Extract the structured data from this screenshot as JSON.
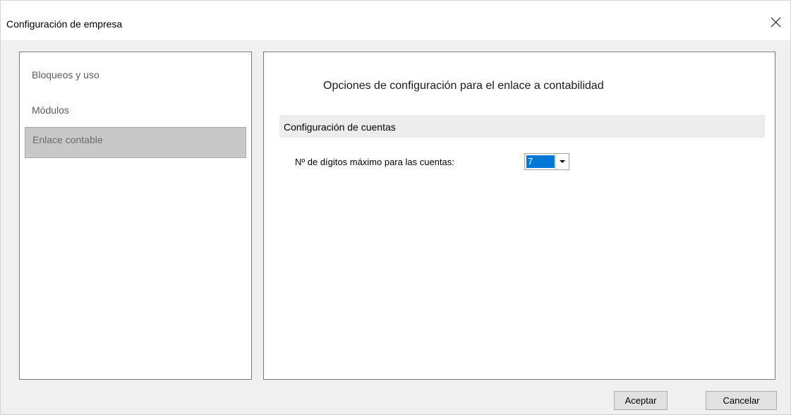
{
  "window": {
    "title": "Configuración de empresa",
    "close_icon": "close-icon"
  },
  "nav": {
    "items": [
      {
        "label": "Bloqueos y uso",
        "selected": false
      },
      {
        "label": "Módulos",
        "selected": false
      },
      {
        "label": "Enlace contable",
        "selected": true
      }
    ]
  },
  "content": {
    "heading": "Opciones de configuración para el enlace a contabilidad",
    "section_title": "Configuración de cuentas",
    "field_label": "Nº de dígitos máximo para las cuentas:",
    "field_value": "7",
    "field_arrow_icon": "chevron-down-icon"
  },
  "buttons": {
    "ok_label": "Aceptar",
    "cancel_label": "Cancelar"
  },
  "colors": {
    "selection_highlight": "#0078d7",
    "nav_selected_bg": "#c8c8c8",
    "section_bar_bg": "#ececec"
  }
}
